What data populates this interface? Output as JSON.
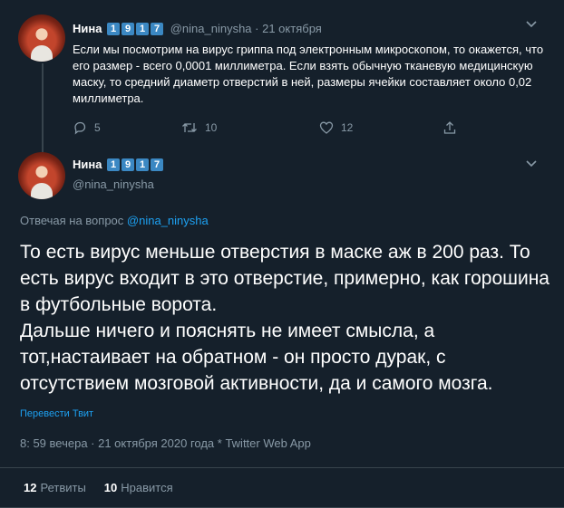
{
  "tweet1": {
    "name": "Нина",
    "badges": [
      "1",
      "9",
      "1",
      "7"
    ],
    "handle": "@nina_ninysha",
    "date": "· 21 октября",
    "text": "Если мы посмотрим на вирус гриппа под электронным микроскопом, то окажется, что его размер - всего 0,0001 миллиметра. Если взять обычную тканевую медицинскую маску, то средний диаметр отверстий в ней, размеры ячейки составляет около 0,02 миллиметра.",
    "replies": "5",
    "retweets": "10",
    "likes": "12"
  },
  "tweet2": {
    "name": "Нина",
    "badges": [
      "1",
      "9",
      "1",
      "7"
    ],
    "handle": "@nina_ninysha",
    "reply_prefix": "Отвечая на вопрос ",
    "reply_handle": "@nina_ninysha",
    "text": "То есть вирус меньше отверстия в маске аж в 200 раз. То есть вирус входит в это отверстие, примерно, как горошина в футбольные ворота.\nДальше ничего и пояснять не имеет смысла, а тот,настаивает на обратном - он просто дурак, с отсутствием мозговой активности, да и самого мозга.",
    "translate": "Перевести Твит",
    "meta": "8: 59 вечера · 21 октября 2020 года * Twitter Web App",
    "retweets_count": "12",
    "retweets_label": "Ретвиты",
    "likes_count": "10",
    "likes_label": "Нравится"
  },
  "colors": {
    "background": "#15202b",
    "muted": "#8899a6",
    "link": "#1da1f2",
    "badge": "#3b88c3",
    "divider": "#38444d"
  },
  "icons": [
    "reply-icon",
    "retweet-icon",
    "like-icon",
    "share-icon",
    "chevron-down-icon"
  ]
}
